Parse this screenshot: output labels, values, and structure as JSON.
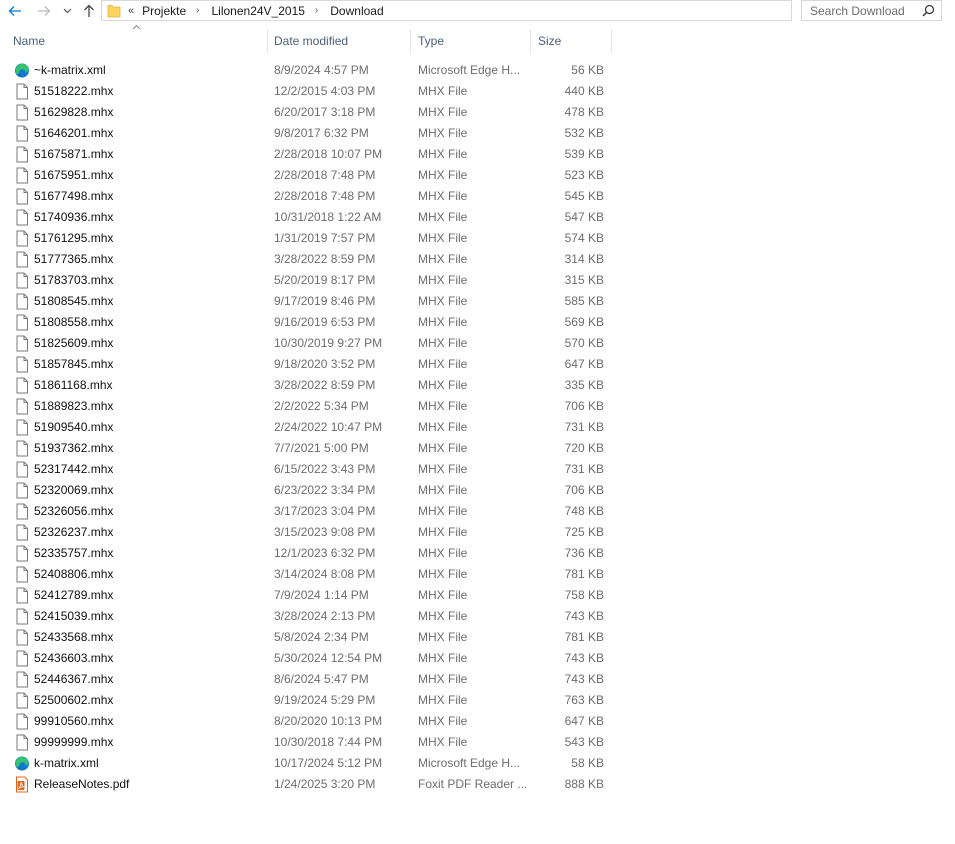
{
  "nav": {
    "back_icon": "arrow-left-icon",
    "forward_icon": "arrow-right-icon",
    "recent_icon": "chevron-down-icon",
    "up_icon": "arrow-up-icon"
  },
  "address": {
    "lead": "«",
    "crumbs": [
      "Projekte",
      "Lilonen24V_2015",
      "Download"
    ]
  },
  "search": {
    "placeholder": "Search Download"
  },
  "columns": {
    "name": "Name",
    "date": "Date modified",
    "type": "Type",
    "size": "Size"
  },
  "colors": {
    "accent": "#0078d7",
    "header_text": "#4c607a",
    "folder": "#ffd35f",
    "pdf": "#e0661f"
  },
  "files": [
    {
      "name": "~k-matrix.xml",
      "date": "8/9/2024 4:57 PM",
      "type": "Microsoft Edge H...",
      "size": "56 KB",
      "icon": "edge-icon"
    },
    {
      "name": "51518222.mhx",
      "date": "12/2/2015 4:03 PM",
      "type": "MHX File",
      "size": "440 KB",
      "icon": "file-icon"
    },
    {
      "name": "51629828.mhx",
      "date": "6/20/2017 3:18 PM",
      "type": "MHX File",
      "size": "478 KB",
      "icon": "file-icon"
    },
    {
      "name": "51646201.mhx",
      "date": "9/8/2017 6:32 PM",
      "type": "MHX File",
      "size": "532 KB",
      "icon": "file-icon"
    },
    {
      "name": "51675871.mhx",
      "date": "2/28/2018 10:07 PM",
      "type": "MHX File",
      "size": "539 KB",
      "icon": "file-icon"
    },
    {
      "name": "51675951.mhx",
      "date": "2/28/2018 7:48 PM",
      "type": "MHX File",
      "size": "523 KB",
      "icon": "file-icon"
    },
    {
      "name": "51677498.mhx",
      "date": "2/28/2018 7:48 PM",
      "type": "MHX File",
      "size": "545 KB",
      "icon": "file-icon"
    },
    {
      "name": "51740936.mhx",
      "date": "10/31/2018 1:22 AM",
      "type": "MHX File",
      "size": "547 KB",
      "icon": "file-icon"
    },
    {
      "name": "51761295.mhx",
      "date": "1/31/2019 7:57 PM",
      "type": "MHX File",
      "size": "574 KB",
      "icon": "file-icon"
    },
    {
      "name": "51777365.mhx",
      "date": "3/28/2022 8:59 PM",
      "type": "MHX File",
      "size": "314 KB",
      "icon": "file-icon"
    },
    {
      "name": "51783703.mhx",
      "date": "5/20/2019 8:17 PM",
      "type": "MHX File",
      "size": "315 KB",
      "icon": "file-icon"
    },
    {
      "name": "51808545.mhx",
      "date": "9/17/2019 8:46 PM",
      "type": "MHX File",
      "size": "585 KB",
      "icon": "file-icon"
    },
    {
      "name": "51808558.mhx",
      "date": "9/16/2019 6:53 PM",
      "type": "MHX File",
      "size": "569 KB",
      "icon": "file-icon"
    },
    {
      "name": "51825609.mhx",
      "date": "10/30/2019 9:27 PM",
      "type": "MHX File",
      "size": "570 KB",
      "icon": "file-icon"
    },
    {
      "name": "51857845.mhx",
      "date": "9/18/2020 3:52 PM",
      "type": "MHX File",
      "size": "647 KB",
      "icon": "file-icon"
    },
    {
      "name": "51861168.mhx",
      "date": "3/28/2022 8:59 PM",
      "type": "MHX File",
      "size": "335 KB",
      "icon": "file-icon"
    },
    {
      "name": "51889823.mhx",
      "date": "2/2/2022 5:34 PM",
      "type": "MHX File",
      "size": "706 KB",
      "icon": "file-icon"
    },
    {
      "name": "51909540.mhx",
      "date": "2/24/2022 10:47 PM",
      "type": "MHX File",
      "size": "731 KB",
      "icon": "file-icon"
    },
    {
      "name": "51937362.mhx",
      "date": "7/7/2021 5:00 PM",
      "type": "MHX File",
      "size": "720 KB",
      "icon": "file-icon"
    },
    {
      "name": "52317442.mhx",
      "date": "6/15/2022 3:43 PM",
      "type": "MHX File",
      "size": "731 KB",
      "icon": "file-icon"
    },
    {
      "name": "52320069.mhx",
      "date": "6/23/2022 3:34 PM",
      "type": "MHX File",
      "size": "706 KB",
      "icon": "file-icon"
    },
    {
      "name": "52326056.mhx",
      "date": "3/17/2023 3:04 PM",
      "type": "MHX File",
      "size": "748 KB",
      "icon": "file-icon"
    },
    {
      "name": "52326237.mhx",
      "date": "3/15/2023 9:08 PM",
      "type": "MHX File",
      "size": "725 KB",
      "icon": "file-icon"
    },
    {
      "name": "52335757.mhx",
      "date": "12/1/2023 6:32 PM",
      "type": "MHX File",
      "size": "736 KB",
      "icon": "file-icon"
    },
    {
      "name": "52408806.mhx",
      "date": "3/14/2024 8:08 PM",
      "type": "MHX File",
      "size": "781 KB",
      "icon": "file-icon"
    },
    {
      "name": "52412789.mhx",
      "date": "7/9/2024 1:14 PM",
      "type": "MHX File",
      "size": "758 KB",
      "icon": "file-icon"
    },
    {
      "name": "52415039.mhx",
      "date": "3/28/2024 2:13 PM",
      "type": "MHX File",
      "size": "743 KB",
      "icon": "file-icon"
    },
    {
      "name": "52433568.mhx",
      "date": "5/8/2024 2:34 PM",
      "type": "MHX File",
      "size": "781 KB",
      "icon": "file-icon"
    },
    {
      "name": "52436603.mhx",
      "date": "5/30/2024 12:54 PM",
      "type": "MHX File",
      "size": "743 KB",
      "icon": "file-icon"
    },
    {
      "name": "52446367.mhx",
      "date": "8/6/2024 5:47 PM",
      "type": "MHX File",
      "size": "743 KB",
      "icon": "file-icon"
    },
    {
      "name": "52500602.mhx",
      "date": "9/19/2024 5:29 PM",
      "type": "MHX File",
      "size": "763 KB",
      "icon": "file-icon"
    },
    {
      "name": "99910560.mhx",
      "date": "8/20/2020 10:13 PM",
      "type": "MHX File",
      "size": "647 KB",
      "icon": "file-icon"
    },
    {
      "name": "99999999.mhx",
      "date": "10/30/2018 7:44 PM",
      "type": "MHX File",
      "size": "543 KB",
      "icon": "file-icon"
    },
    {
      "name": "k-matrix.xml",
      "date": "10/17/2024 5:12 PM",
      "type": "Microsoft Edge H...",
      "size": "58 KB",
      "icon": "edge-icon"
    },
    {
      "name": "ReleaseNotes.pdf",
      "date": "1/24/2025 3:20 PM",
      "type": "Foxit PDF Reader ...",
      "size": "888 KB",
      "icon": "pdf-icon"
    }
  ]
}
